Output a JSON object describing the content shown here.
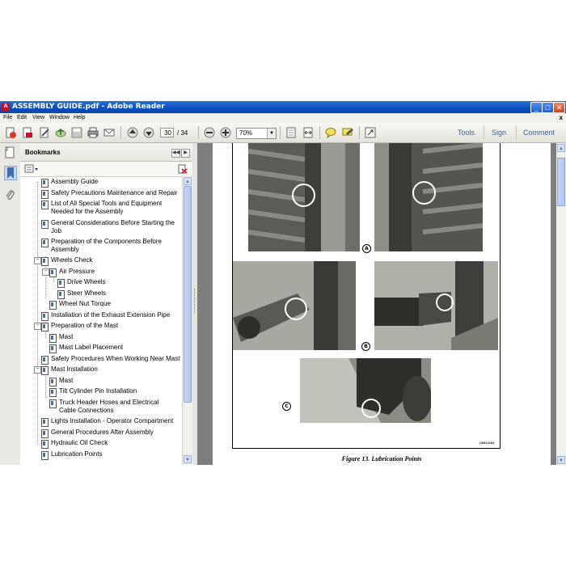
{
  "window": {
    "title": "ASSEMBLY GUIDE.pdf - Adobe Reader",
    "title_icon_text": "A",
    "controls": {
      "minimize": "_",
      "maximize": "□",
      "close": "✕"
    }
  },
  "menu": {
    "items": [
      "File",
      "Edit",
      "View",
      "Window",
      "Help"
    ],
    "close_glyph": "x"
  },
  "toolbar": {
    "current_page": "30",
    "page_separator": "/",
    "total_pages": "34",
    "zoom": "70%",
    "links": [
      "Tools",
      "Sign",
      "Comment"
    ]
  },
  "bookmarks": {
    "title": "Bookmarks",
    "items": [
      "Assembly Guide",
      "Safety Precautions Maintenance and Repair",
      "List of All Special Tools and Equipment Needed for the Assembly",
      "General Considerations Before Starting the Job",
      "Preparation of the Components Before Assembly",
      "Wheels Check",
      "Air Pressure",
      "Drive Wheels",
      "Steer Wheels",
      "Wheel Nut Torque",
      "Installation of the Exhaust Extension Pipe",
      "Preparation of the Mast",
      "Mast",
      "Mast Label Placement",
      "Safety Procedures When Working Near Mast",
      "Mast Installation",
      "Mast",
      "Tilt Cylinder Pin Installation",
      "Truck Header Hoses and Electrical Cable Connections",
      "Lights Installation - Operator Compartment",
      "General Procedures After Assembly",
      "Hydraulic Oil Check",
      "Lubrication Points"
    ]
  },
  "document": {
    "callouts": [
      "A",
      "B",
      "C"
    ],
    "figure_code": "U0812184",
    "figure_caption": "Figure 13. Lubrication Points"
  },
  "colors": {
    "titlebar": "#0a4fc0",
    "doc_background": "#7e7e7e",
    "toolbar_link": "#3d5f8f",
    "bookmark_icon": "#3d6fb6"
  }
}
